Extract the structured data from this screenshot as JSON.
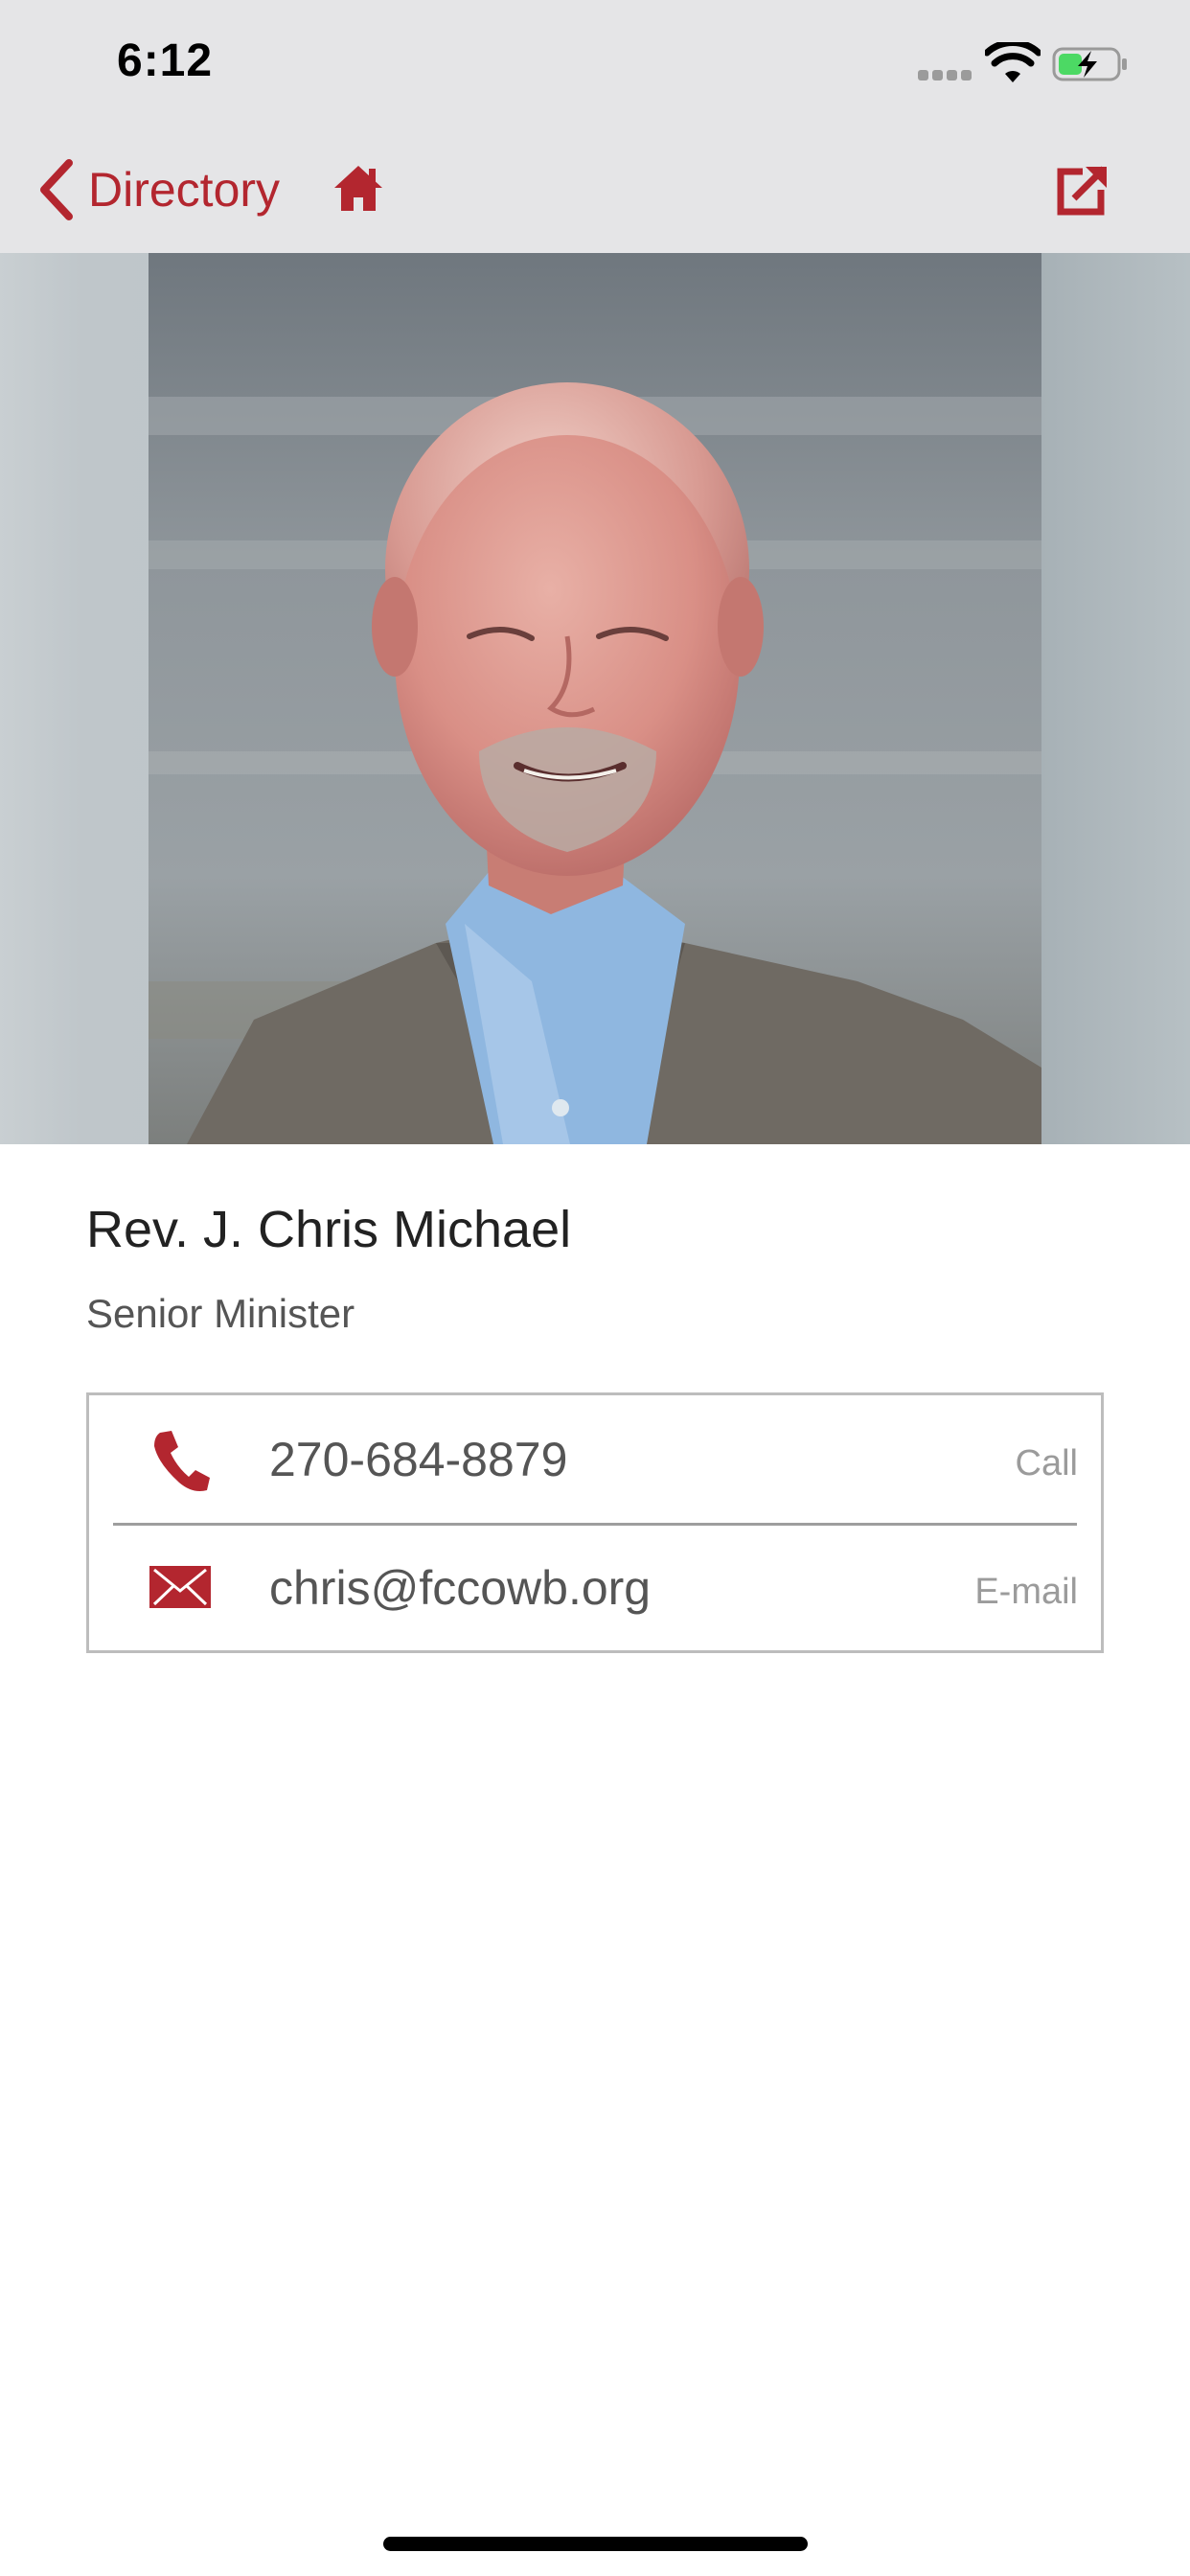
{
  "status_bar": {
    "time": "6:12",
    "signal_icon": "cellular-signal-icon",
    "wifi_icon": "wifi-icon",
    "battery_icon": "battery-charging-icon",
    "battery_level": 0.35
  },
  "nav": {
    "back_label": "Directory",
    "back_icon": "chevron-left-icon",
    "home_icon": "home-icon",
    "share_icon": "external-link-icon"
  },
  "profile": {
    "photo": "profile-photo",
    "name": "Rev. J. Chris Michael",
    "title": "Senior Minister"
  },
  "contacts": {
    "phone": {
      "value": "270-684-8879",
      "action": "Call",
      "icon": "phone-icon"
    },
    "email": {
      "value": "chris@fccowb.org",
      "action": "E-mail",
      "icon": "envelope-icon"
    }
  },
  "colors": {
    "accent": "#b3262f",
    "nav_background": "#e5e5e7",
    "text_primary": "#222222",
    "text_secondary": "#555555",
    "text_muted": "#9b9b9b"
  }
}
